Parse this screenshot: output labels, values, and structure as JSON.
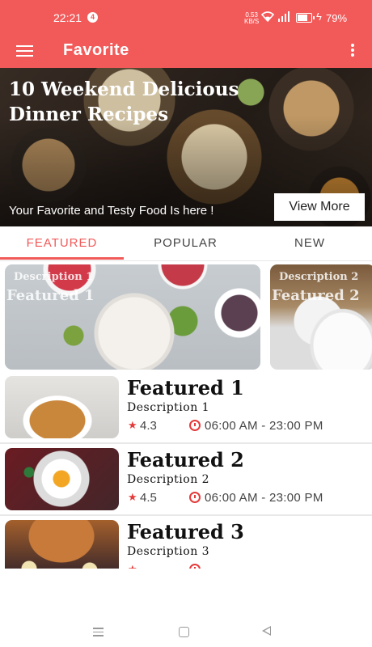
{
  "status_bar": {
    "time": "22:21",
    "notification_count": "4",
    "net_speed": "0.53\nKB/S",
    "battery": "79%"
  },
  "app_bar": {
    "title": "Favorite",
    "menu_icon": "hamburger-menu-icon",
    "more_icon": "more-vertical-icon"
  },
  "hero": {
    "title": "10 Weekend Delicious Dinner Recipes",
    "subtitle": "Your Favorite and Testy Food Is here !",
    "button_label": "View More"
  },
  "tabs": [
    {
      "label": "FEATURED",
      "active": true
    },
    {
      "label": "POPULAR",
      "active": false
    },
    {
      "label": "NEW",
      "active": false
    }
  ],
  "carousel": [
    {
      "description": "Description 1",
      "name": "Featured 1"
    },
    {
      "description": "Description 2",
      "name": "Featured 2"
    }
  ],
  "list": [
    {
      "title": "Featured 1",
      "description": "Description 1",
      "rating": "4.3",
      "hours": "06:00 AM - 23:00 PM"
    },
    {
      "title": "Featured 2",
      "description": "Description 2",
      "rating": "4.5",
      "hours": "06:00 AM - 23:00 PM"
    },
    {
      "title": "Featured 3",
      "description": "Description 3",
      "rating": "",
      "hours": ""
    }
  ],
  "colors": {
    "primary": "#f25a5a",
    "accent_red": "#e53a3a",
    "text_dark": "#111111"
  },
  "icons": {
    "rating": "star-icon",
    "hours": "clock-icon",
    "nav": [
      "recent-apps-icon",
      "home-icon",
      "back-icon"
    ]
  }
}
